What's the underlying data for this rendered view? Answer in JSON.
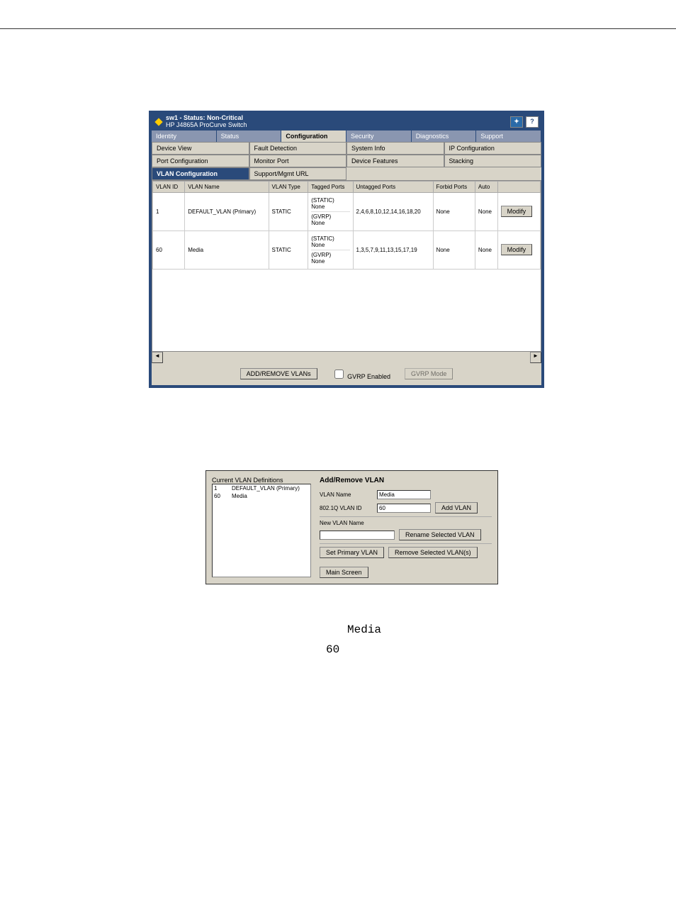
{
  "titlebar": {
    "title": "sw1 - Status: Non-Critical",
    "subtitle": "HP J4865A ProCurve Switch",
    "hp_icon": "hp",
    "help_icon": "?"
  },
  "maintabs": [
    "Identity",
    "Status",
    "Configuration",
    "Security",
    "Diagnostics",
    "Support"
  ],
  "maintab_active": 2,
  "subtabs_rows": [
    [
      "Device View",
      "Fault Detection",
      "System Info",
      "IP Configuration"
    ],
    [
      "Port Configuration",
      "Monitor Port",
      "Device Features",
      "Stacking"
    ],
    [
      "VLAN Configuration",
      "Support/Mgmt URL",
      "",
      ""
    ]
  ],
  "subtab_active": {
    "row": 2,
    "col": 0
  },
  "table": {
    "headers": [
      "VLAN ID",
      "VLAN Name",
      "VLAN Type",
      "Tagged Ports",
      "Untagged Ports",
      "Forbid Ports",
      "Auto",
      ""
    ],
    "rows": [
      {
        "id": "1",
        "name": "DEFAULT_VLAN (Primary)",
        "type": "STATIC",
        "tagged": [
          [
            "(STATIC)",
            "None"
          ],
          [
            "(GVRP)",
            "None"
          ]
        ],
        "untagged": "2,4,6,8,10,12,14,16,18,20",
        "forbid": "None",
        "auto": "None",
        "action": "Modify"
      },
      {
        "id": "60",
        "name": "Media",
        "type": "STATIC",
        "tagged": [
          [
            "(STATIC)",
            "None"
          ],
          [
            "(GVRP)",
            "None"
          ]
        ],
        "untagged": "1,3,5,7,9,11,13,15,17,19",
        "forbid": "None",
        "auto": "None",
        "action": "Modify"
      }
    ]
  },
  "footer": {
    "add_remove": "ADD/REMOVE VLANs",
    "gvrp_label": "GVRP Enabled",
    "gvrp_mode": "GVRP Mode"
  },
  "dialog": {
    "list_heading": "Current VLAN Definitions",
    "list": [
      {
        "id": "1",
        "name": "DEFAULT_VLAN (Primary)"
      },
      {
        "id": "60",
        "name": "Media"
      }
    ],
    "heading": "Add/Remove VLAN",
    "vlan_name_label": "VLAN Name",
    "vlan_name_value": "Media",
    "vlan_id_label": "802.1Q VLAN ID",
    "vlan_id_value": "60",
    "add_vlan": "Add VLAN",
    "new_name_label": "New VLAN Name",
    "rename": "Rename Selected VLAN",
    "set_primary": "Set Primary VLAN",
    "remove": "Remove Selected VLAN(s)",
    "main_screen": "Main Screen"
  },
  "captions": {
    "media": "Media",
    "page": "60"
  }
}
